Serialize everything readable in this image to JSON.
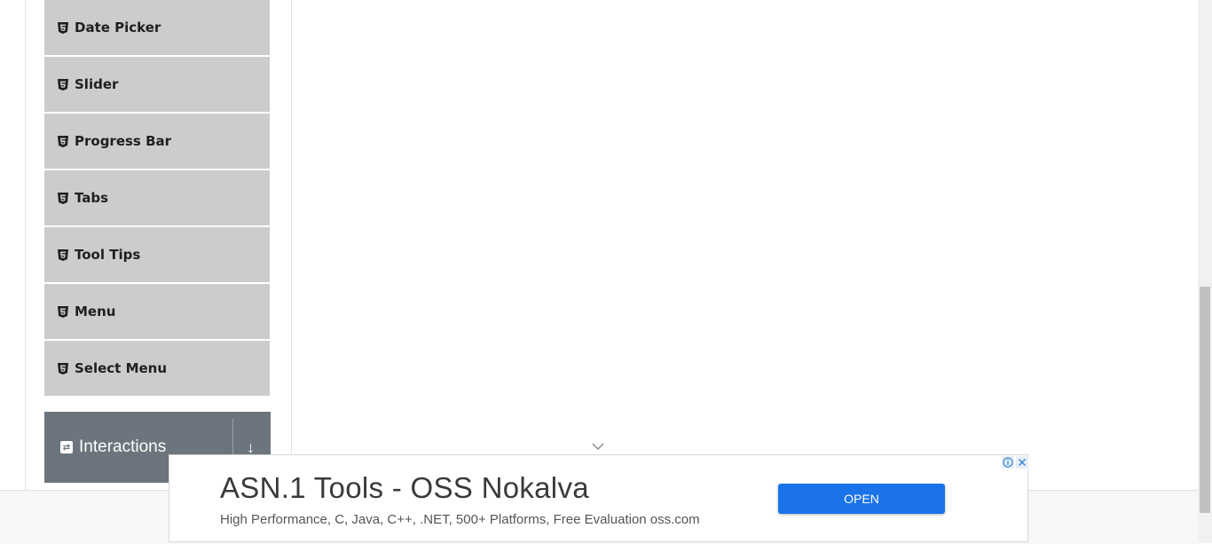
{
  "sidebar": {
    "items": [
      {
        "label": "Date Picker",
        "icon": "html5-icon"
      },
      {
        "label": "Slider",
        "icon": "html5-icon"
      },
      {
        "label": "Progress Bar",
        "icon": "html5-icon"
      },
      {
        "label": "Tabs",
        "icon": "html5-icon"
      },
      {
        "label": "Tool Tips",
        "icon": "html5-icon"
      },
      {
        "label": "Menu",
        "icon": "html5-icon"
      },
      {
        "label": "Select Menu",
        "icon": "html5-icon"
      }
    ],
    "group": {
      "label": "Interactions",
      "icon": "refresh-icon",
      "arrow_icon": "arrow-down-icon"
    }
  },
  "ad": {
    "title": "ASN.1 Tools - OSS Nokalva",
    "description": "High Performance, C, Java, C++, .NET, 500+ Platforms, Free Evaluation oss.com",
    "button_label": "OPEN",
    "accent_color": "#1a73e8",
    "info_icon": "info-icon",
    "close_icon": "close-icon"
  },
  "colors": {
    "menu_item_bg": "#cccccc",
    "group_header_bg": "#6c757d"
  }
}
